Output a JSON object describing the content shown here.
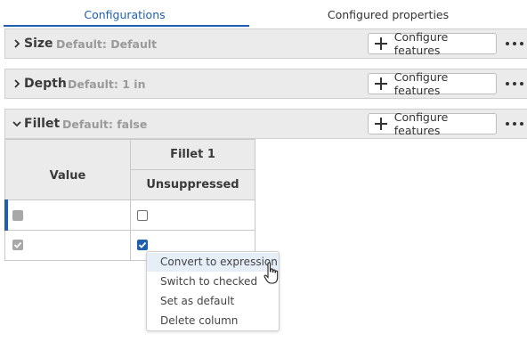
{
  "tabs": {
    "configurations": "Configurations",
    "configured_properties": "Configured properties"
  },
  "sections": [
    {
      "title": "Size",
      "default": "Default: Default",
      "expanded": false,
      "button": "Configure features"
    },
    {
      "title": "Depth",
      "default": "Default: 1 in",
      "expanded": false,
      "button": "Configure features"
    },
    {
      "title": "Fillet",
      "default": "Default: false",
      "expanded": true,
      "button": "Configure features"
    }
  ],
  "table": {
    "col_value": "Value",
    "col_feature": "Fillet 1",
    "col_sub": "Unsuppressed",
    "rows": [
      {
        "value_checked": false,
        "fillet_checked": false,
        "selected": true
      },
      {
        "value_checked": true,
        "fillet_checked": true,
        "selected": false
      }
    ]
  },
  "context_menu": {
    "items": [
      "Convert to expression",
      "Switch to checked",
      "Set as default",
      "Delete column"
    ],
    "hovered_index": 0
  },
  "colors": {
    "accent": "#1f5fae",
    "section_bg": "#ebebeb",
    "muted_text": "#9a9a9a"
  },
  "icons": {
    "chevron": "chevron-icon",
    "plus": "plus-icon",
    "more": "more-icon",
    "cursor": "hand-pointer-icon"
  }
}
